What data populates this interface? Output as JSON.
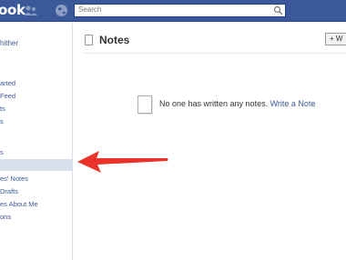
{
  "topbar": {
    "logo": "ook",
    "search_placeholder": "Search"
  },
  "sidebar": {
    "profile_name": "hither",
    "items": [
      {
        "label": "arted"
      },
      {
        "label": "Feed"
      },
      {
        "label": "ts"
      },
      {
        "label": "s"
      },
      {
        "label": "s"
      },
      {
        "label": "es' Notes"
      },
      {
        "label": "Drafts"
      },
      {
        "label": "es About Me"
      },
      {
        "label": "ons"
      }
    ]
  },
  "main": {
    "title": "Notes",
    "write_button": "+ W",
    "empty_message": "No one has written any notes.",
    "empty_link": "Write a Note"
  },
  "colors": {
    "brand_blue": "#3b5998",
    "arrow_red": "#e8322a",
    "selected_bg": "#d8dfea"
  }
}
